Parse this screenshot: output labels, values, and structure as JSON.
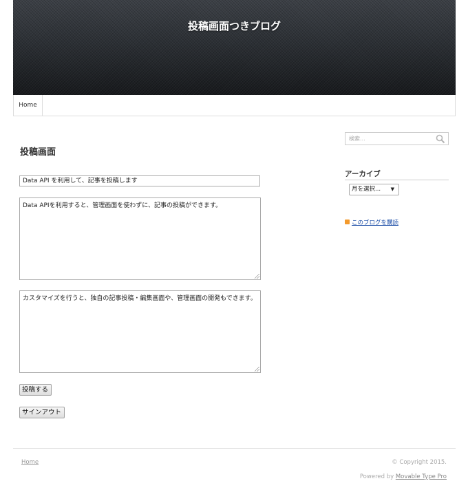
{
  "header": {
    "site_title": "投稿画面つきブログ"
  },
  "nav": {
    "home_label": "Home"
  },
  "main": {
    "heading": "投稿画面",
    "title_value": "Data API を利用して、記事を投稿します",
    "body_value": "Data APIを利用すると、管理画面を使わずに、記事の投稿ができます。",
    "more_value": "カスタマイズを行うと、独自の記事投稿・編集画面や、管理画面の開発もできます。",
    "post_button": "投稿する",
    "signout_button": "サインアウト"
  },
  "sidebar": {
    "search_placeholder": "検索...",
    "archive_heading": "アーカイブ",
    "month_select_value": "月を選択...",
    "feed_link": "このブログを購読"
  },
  "footer": {
    "home_link": "Home",
    "copyright": "© Copyright 2015.",
    "powered_prefix": "Powered by ",
    "powered_link": "Movable Type Pro"
  },
  "colors": {
    "link_blue": "#1e4fa8",
    "feed_orange": "#f39a2c",
    "banner_dark": "#17191c"
  },
  "icons": {
    "search": "search-icon",
    "feed": "rss-feed-icon",
    "select_arrow": "chevron-down-icon"
  }
}
